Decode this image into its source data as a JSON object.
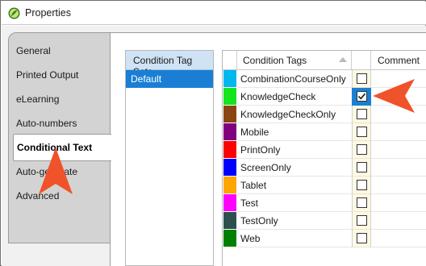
{
  "window": {
    "title": "Properties",
    "icon": "app-leaf-icon"
  },
  "sidebar": {
    "items": [
      {
        "label": "General"
      },
      {
        "label": "Printed Output"
      },
      {
        "label": "eLearning"
      },
      {
        "label": "Auto-numbers"
      },
      {
        "label": "Conditional Text"
      },
      {
        "label": "Auto-generate"
      },
      {
        "label": "Advanced"
      }
    ],
    "selected": "Conditional Text"
  },
  "condition_tag_sets": {
    "header": "Condition Tag Sets",
    "rows": [
      {
        "label": "Default",
        "selected": true
      }
    ]
  },
  "tags_grid": {
    "columns": {
      "tag": "Condition Tags",
      "comment": "Comment"
    },
    "rows": [
      {
        "name": "CombinationCourseOnly",
        "color": "#00b7f0",
        "checked": false
      },
      {
        "name": "KnowledgeCheck",
        "color": "#14e61e",
        "checked": true
      },
      {
        "name": "KnowledgeCheckOnly",
        "color": "#8b4513",
        "checked": false
      },
      {
        "name": "Mobile",
        "color": "#800080",
        "checked": false
      },
      {
        "name": "PrintOnly",
        "color": "#ff0000",
        "checked": false
      },
      {
        "name": "ScreenOnly",
        "color": "#0000ff",
        "checked": false
      },
      {
        "name": "Tablet",
        "color": "#ffa500",
        "checked": false
      },
      {
        "name": "Test",
        "color": "#ff00ff",
        "checked": false
      },
      {
        "name": "TestOnly",
        "color": "#2f4f4f",
        "checked": false
      },
      {
        "name": "Web",
        "color": "#008000",
        "checked": false
      }
    ]
  },
  "colors": {
    "accent": "#1a7fd4",
    "callout": "#f0522a"
  }
}
